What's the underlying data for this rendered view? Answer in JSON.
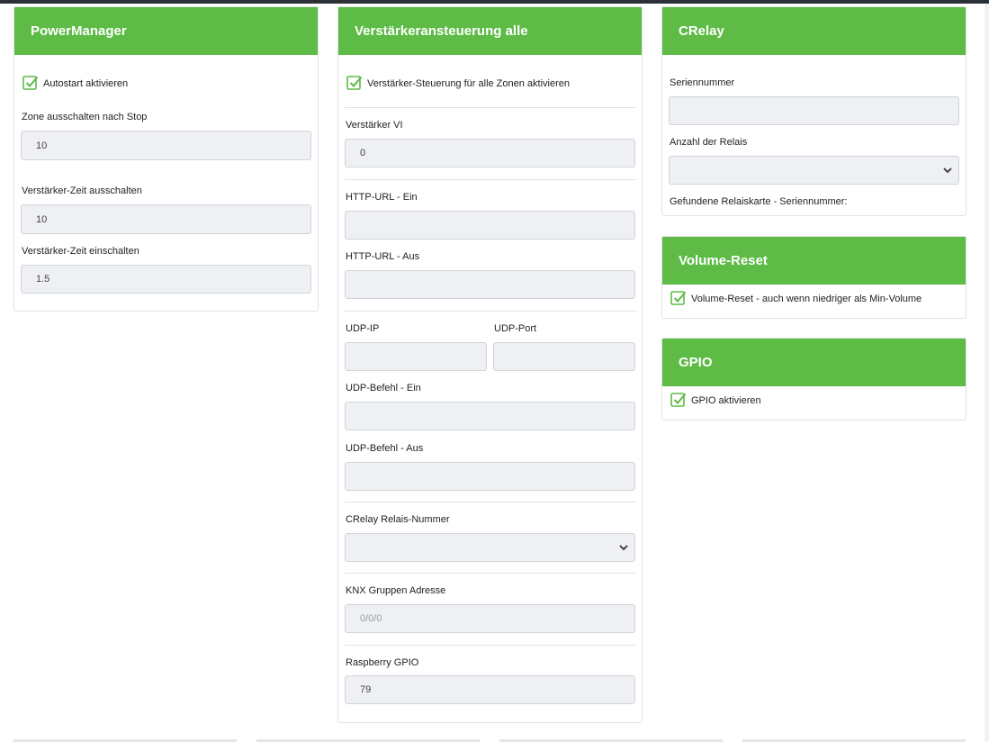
{
  "power_manager": {
    "title": "PowerManager",
    "autostart_label": "Autostart aktivieren",
    "zone_off_label": "Zone ausschalten nach Stop",
    "zone_off_value": "10",
    "amp_off_label": "Verstärker-Zeit ausschalten",
    "amp_off_value": "10",
    "amp_on_label": "Verstärker-Zeit einschalten",
    "amp_on_value": "1.5"
  },
  "amp_all": {
    "title": "Verstärkeransteuerung alle",
    "enable_label": "Verstärker-Steuerung für alle Zonen aktivieren",
    "vi_label": "Verstärker VI",
    "vi_value": "0",
    "http_on_label": "HTTP-URL - Ein",
    "http_off_label": "HTTP-URL - Aus",
    "udp_ip_label": "UDP-IP",
    "udp_port_label": "UDP-Port",
    "udp_cmd_on_label": "UDP-Befehl - Ein",
    "udp_cmd_off_label": "UDP-Befehl - Aus",
    "crelay_nr_label": "CRelay Relais-Nummer",
    "knx_label": "KNX Gruppen Adresse",
    "knx_placeholder": "0/0/0",
    "gpio_label": "Raspberry GPIO",
    "gpio_value": "79"
  },
  "crelay": {
    "title": "CRelay",
    "serial_label": "Seriennummer",
    "relay_count_label": "Anzahl der Relais",
    "found_label": "Gefundene Relaiskarte - Seriennummer:"
  },
  "volume_reset": {
    "title": "Volume-Reset",
    "enable_label": "Volume-Reset - auch wenn niedriger als Min-Volume"
  },
  "gpio": {
    "title": "GPIO",
    "enable_label": "GPIO aktivieren"
  },
  "colors": {
    "accent": "#5dbb46",
    "input_bg": "#eef0f3"
  },
  "icons": {
    "checkbox": "checkbox-checked-icon",
    "select": "chevron-down-icon"
  }
}
